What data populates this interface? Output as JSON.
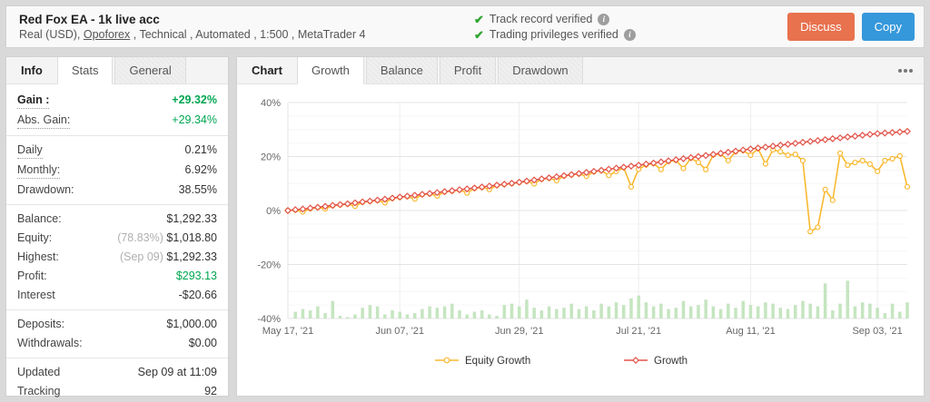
{
  "header": {
    "title": "Red Fox EA - 1k live acc",
    "subtitle_prefix": "Real (USD), ",
    "broker": "Opoforex",
    "subtitle_suffix": " , Technical , Automated , 1:500 , MetaTrader 4",
    "verifications": [
      "Track record verified",
      "Trading privileges verified"
    ],
    "discuss_label": "Discuss",
    "copy_label": "Copy"
  },
  "stats_panel": {
    "label": "Info",
    "tabs": [
      "Stats",
      "General"
    ],
    "active_tab": "Stats",
    "groups": [
      [
        {
          "label": "Gain :",
          "value": "+29.32%",
          "dotted": true,
          "bold": true,
          "green": true
        },
        {
          "label": "Abs. Gain:",
          "value": "+29.34%",
          "dotted": true,
          "green": true
        }
      ],
      [
        {
          "label": "Daily",
          "value": "0.21%",
          "dotted": true
        },
        {
          "label": "Monthly:",
          "value": "6.92%",
          "dotted": true
        },
        {
          "label": "Drawdown:",
          "value": "38.55%"
        }
      ],
      [
        {
          "label": "Balance:",
          "value": "$1,292.33"
        },
        {
          "label": "Equity:",
          "muted": "(78.83%) ",
          "value": "$1,018.80"
        },
        {
          "label": "Highest:",
          "muted": "(Sep 09) ",
          "value": "$1,292.33"
        },
        {
          "label": "Profit:",
          "value": "$293.13",
          "green": true
        },
        {
          "label": "Interest",
          "value": "-$20.66"
        }
      ],
      [
        {
          "label": "Deposits:",
          "value": "$1,000.00"
        },
        {
          "label": "Withdrawals:",
          "value": "$0.00"
        }
      ],
      [
        {
          "label": "Updated",
          "value": "Sep 09 at 11:09"
        },
        {
          "label": "Tracking",
          "value": "92"
        }
      ]
    ]
  },
  "chart_panel": {
    "label": "Chart",
    "tabs": [
      "Growth",
      "Balance",
      "Profit",
      "Drawdown"
    ],
    "active_tab": "Growth"
  },
  "chart_data": {
    "type": "line",
    "title": "",
    "unit": "%",
    "ylim": [
      -40,
      40
    ],
    "y_ticks": [
      40,
      20,
      0,
      -20,
      -40
    ],
    "x_tick_indices": [
      0,
      15,
      31,
      47,
      62,
      79
    ],
    "x_tick_labels": [
      "May 17, '21",
      "Jun 07, '21",
      "Jun 29, '21",
      "Jul 21, '21",
      "Aug 11, '21",
      "Sep 03, '21"
    ],
    "grid": true,
    "legend_position": "bottom",
    "series": [
      {
        "name": "Equity Growth",
        "color": "#f9b931",
        "marker": "circle",
        "values": [
          0.0,
          0.2,
          -0.5,
          0.7,
          1.1,
          0.6,
          1.8,
          2.1,
          2.4,
          1.6,
          3.1,
          3.4,
          3.7,
          2.9,
          4.5,
          4.9,
          5.2,
          4.3,
          5.9,
          6.2,
          5.4,
          6.9,
          7.2,
          7.6,
          6.5,
          8.2,
          8.6,
          7.8,
          9.3,
          9.7,
          10.0,
          10.4,
          10.8,
          9.9,
          11.6,
          12.0,
          11.1,
          12.8,
          13.2,
          13.6,
          12.7,
          14.4,
          14.8,
          13.0,
          14.5,
          15.9,
          8.8,
          15.3,
          16.9,
          17.4,
          15.2,
          18.2,
          18.6,
          15.6,
          19.4,
          17.8,
          15.2,
          20.6,
          21.0,
          18.5,
          21.8,
          22.2,
          20.5,
          22.9,
          17.3,
          22.5,
          21.8,
          20.5,
          20.8,
          18.5,
          -7.8,
          -6.2,
          7.8,
          3.8,
          21.2,
          16.8,
          17.8,
          18.5,
          17.2,
          14.5,
          18.5,
          19.2,
          20.2,
          8.8
        ]
      },
      {
        "name": "Growth",
        "color": "#e2544a",
        "marker": "diamond",
        "values": [
          0.0,
          0.3,
          0.55,
          0.9,
          1.2,
          1.55,
          1.9,
          2.2,
          2.5,
          2.85,
          3.2,
          3.5,
          3.85,
          4.2,
          4.6,
          5.0,
          5.3,
          5.65,
          6.0,
          6.3,
          6.65,
          7.0,
          7.35,
          7.7,
          8.0,
          8.35,
          8.7,
          9.05,
          9.4,
          9.75,
          10.1,
          10.5,
          10.9,
          11.3,
          11.7,
          12.1,
          12.5,
          12.9,
          13.3,
          13.7,
          14.1,
          14.5,
          14.9,
          15.3,
          15.7,
          16.05,
          16.45,
          16.8,
          17.2,
          17.6,
          18.0,
          18.4,
          18.8,
          19.2,
          19.6,
          20.0,
          20.4,
          20.8,
          21.2,
          21.6,
          22.0,
          22.4,
          22.8,
          23.15,
          23.5,
          23.85,
          24.2,
          24.55,
          24.9,
          25.25,
          25.6,
          25.9,
          26.25,
          26.6,
          26.9,
          27.25,
          27.55,
          27.9,
          28.2,
          28.5,
          28.7,
          28.9,
          29.1,
          29.32
        ]
      }
    ],
    "bars": {
      "name": "activity",
      "color": "#c5e5c0",
      "values": [
        0,
        2.5,
        3.5,
        3,
        4.5,
        2,
        6.5,
        1,
        0.5,
        1.5,
        4,
        5,
        4.5,
        1.5,
        3,
        2.5,
        1.5,
        2,
        3.5,
        4.5,
        4,
        4.5,
        5.5,
        3,
        1.5,
        2.5,
        3,
        1.5,
        1,
        5,
        5.5,
        4.5,
        7,
        4,
        3,
        4.5,
        3.5,
        4,
        5.5,
        3.5,
        4.5,
        3,
        5.5,
        4.5,
        6,
        5,
        7.5,
        8.5,
        6,
        4.5,
        5.5,
        3.5,
        4,
        6.5,
        4.5,
        5,
        7,
        4.5,
        3.5,
        5.5,
        4,
        6.5,
        5,
        4.5,
        6,
        5.5,
        4,
        3.5,
        5,
        6.5,
        5.5,
        4.5,
        13,
        3,
        5.5,
        14,
        4.5,
        6,
        5.5,
        4,
        2,
        5.5,
        2.5,
        6
      ]
    },
    "colors": {
      "grid_major": "#e4e4e4",
      "grid_minor": "#f6f6f6",
      "grid_vertical": "#ededed",
      "axis_text": "#666"
    }
  }
}
